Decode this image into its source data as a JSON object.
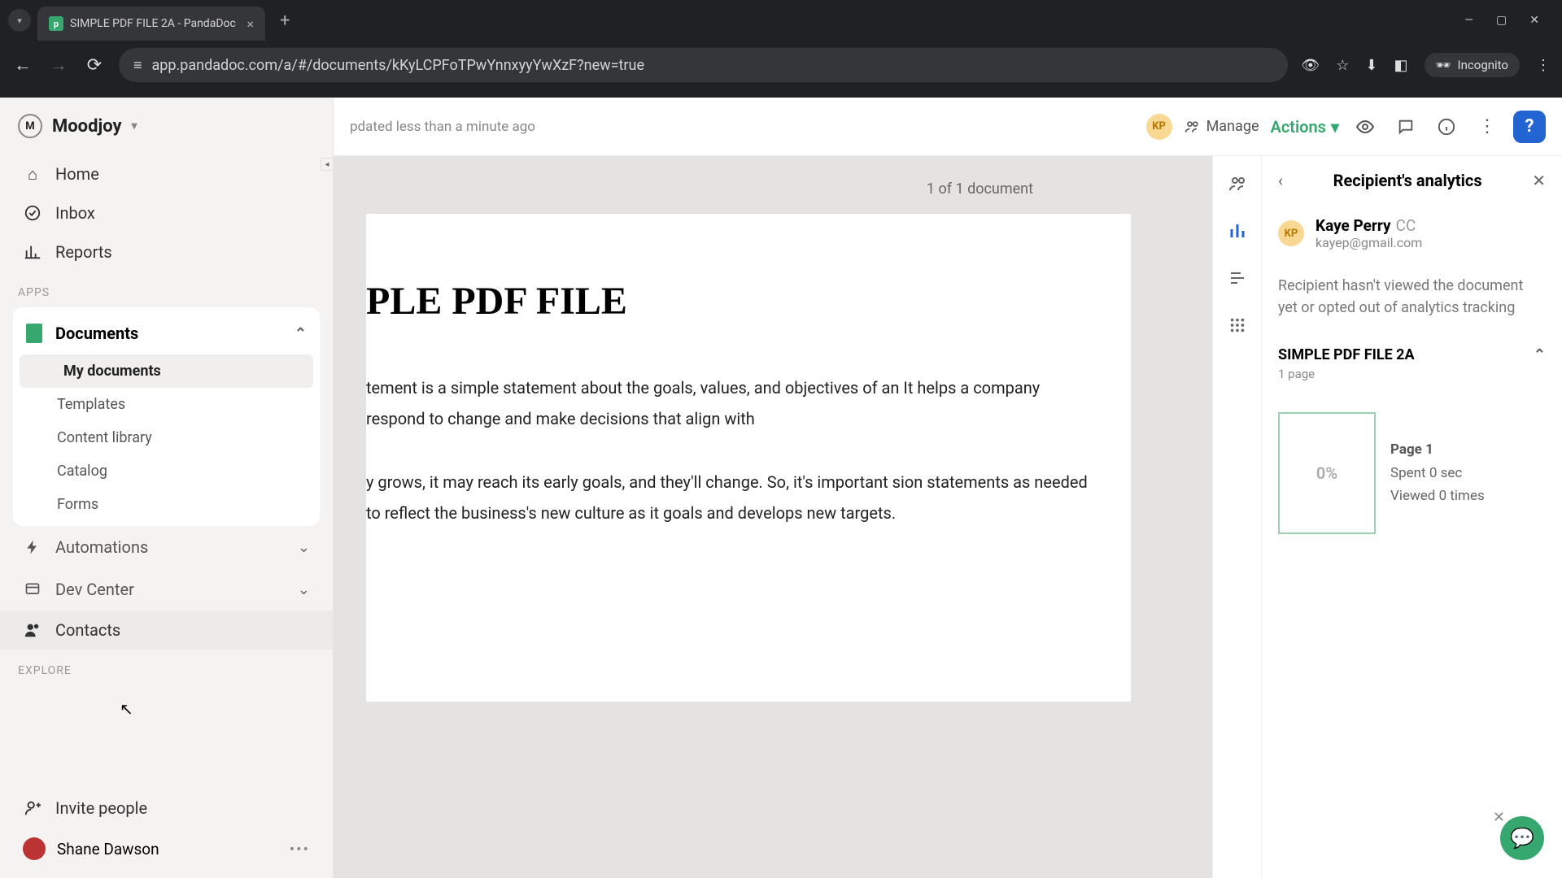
{
  "browser": {
    "tab_title": "SIMPLE PDF FILE 2A - PandaDoc",
    "url": "app.pandadoc.com/a/#/documents/kKyLCPFoTPwYnnxyyYwXzF?new=true",
    "incognito_label": "Incognito"
  },
  "sidebar": {
    "org_name": "Moodjoy",
    "nav": {
      "home": "Home",
      "inbox": "Inbox",
      "reports": "Reports"
    },
    "apps_label": "APPS",
    "documents": {
      "label": "Documents",
      "items": [
        "My documents",
        "Templates",
        "Content library",
        "Catalog",
        "Forms"
      ]
    },
    "automations": "Automations",
    "dev_center": "Dev Center",
    "contacts": "Contacts",
    "explore_label": "EXPLORE",
    "invite_people": "Invite people",
    "user_name": "Shane Dawson"
  },
  "topbar": {
    "updated_text": "pdated less than a minute ago",
    "kp_initials": "KP",
    "manage": "Manage",
    "actions": "Actions"
  },
  "document": {
    "count_label": "1 of 1 document",
    "title": "PLE PDF FILE",
    "para1": "tement is a simple statement about the goals, values, and objectives of an It helps a company respond to change and make decisions that align with",
    "para2": "y grows, it may reach its early goals, and they'll change. So, it's important sion statements as needed to reflect the business's new culture as it goals and develops new targets."
  },
  "analytics": {
    "title": "Recipient's analytics",
    "recipient_initials": "KP",
    "recipient_name": "Kaye Perry",
    "recipient_role": "CC",
    "recipient_email": "kayep@gmail.com",
    "message": "Recipient hasn't viewed the document yet or opted out of analytics tracking",
    "doc_name": "SIMPLE PDF FILE 2A",
    "page_count": "1 page",
    "thumb_percent": "0%",
    "page_label": "Page 1",
    "spent": "Spent 0 sec",
    "viewed": "Viewed 0 times"
  }
}
